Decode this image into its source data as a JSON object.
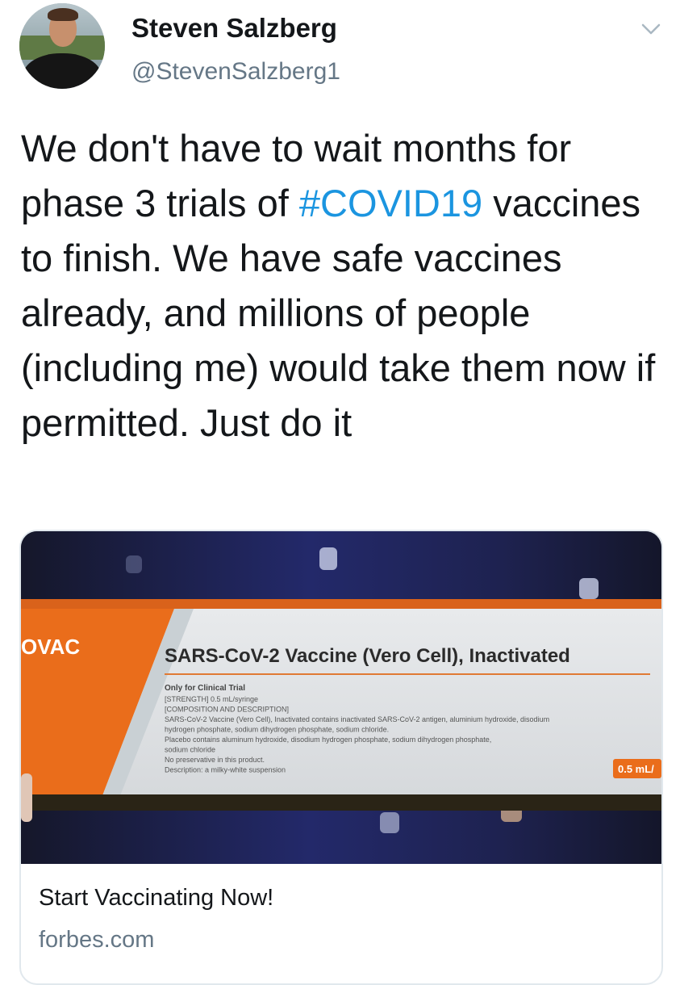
{
  "author": {
    "name": "Steven Salzberg",
    "handle": "@StevenSalzberg1"
  },
  "tweet": {
    "text_before": "We don't have to wait months for phase 3 trials of ",
    "hashtag": "#COVID19",
    "text_after": " vaccines to finish. We have safe vaccines already, and millions of people (including me) would take them now if permitted. Just do it"
  },
  "card": {
    "title": "Start Vaccinating Now!",
    "domain": "forbes.com",
    "image": {
      "brand": "OVAC",
      "product": "SARS-CoV-2 Vaccine (Vero Cell), Inactivated",
      "note": "Only for Clinical Trial",
      "lines": [
        "[STRENGTH] 0.5 mL/syringe",
        "[COMPOSITION AND DESCRIPTION]",
        "SARS-CoV-2 Vaccine (Vero Cell), Inactivated contains inactivated SARS-CoV-2 antigen, aluminium hydroxide, disodium",
        "hydrogen phosphate, sodium dihydrogen phosphate, sodium chloride.",
        "Placebo contains aluminum hydroxide, disodium hydrogen phosphate, sodium dihydrogen phosphate,",
        "sodium chloride",
        "No preservative in this product.",
        "Description: a milky-white suspension"
      ],
      "volume": "0.5 mL/"
    }
  },
  "colors": {
    "text": "#14171a",
    "secondary": "#657786",
    "link": "#1b95e0",
    "border": "#e1e8ed",
    "box_orange": "#ea6d1b"
  },
  "icons": {
    "menu": "chevron-down-icon"
  }
}
